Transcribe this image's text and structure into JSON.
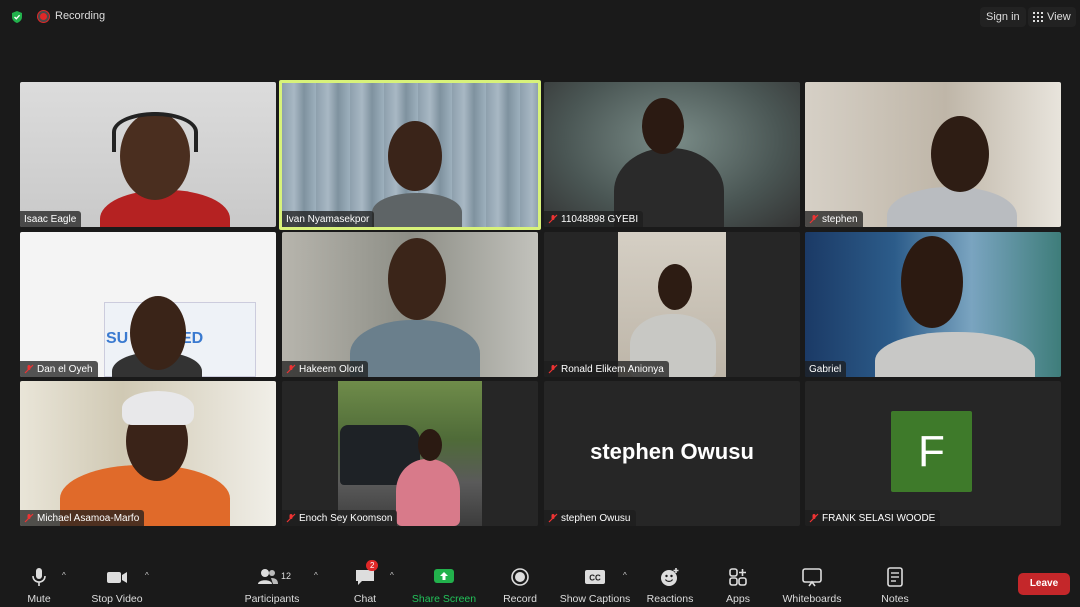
{
  "topbar": {
    "recording_label": "Recording",
    "signin_label": "Sign in",
    "view_label": "View"
  },
  "tiles": [
    {
      "name": "Isaac Eagle",
      "muted": false
    },
    {
      "name": "Ivan Nyamasekpor",
      "muted": false,
      "active": true
    },
    {
      "name": "11048898 GYEBI",
      "muted": true
    },
    {
      "name": "stephen",
      "muted": true
    },
    {
      "name": "Dan el Oyeh",
      "muted": true,
      "banner_text": "SU    ARGED"
    },
    {
      "name": "Hakeem Olord",
      "muted": true
    },
    {
      "name": "Ronald Elikem Anionya",
      "muted": true
    },
    {
      "name": "Gabriel",
      "muted": false
    },
    {
      "name": "Michael Asamoa-Marfo",
      "muted": true
    },
    {
      "name": "Enoch Sey Koomson",
      "muted": true
    },
    {
      "name": "stephen Owusu",
      "muted": true,
      "display_text": "stephen Owusu"
    },
    {
      "name": "FRANK SELASI WOODE",
      "muted": true,
      "avatar_letter": "F"
    }
  ],
  "toolbar": {
    "mute": "Mute",
    "stop_video": "Stop Video",
    "participants": "Participants",
    "participants_count": "12",
    "chat": "Chat",
    "chat_badge": "2",
    "share_screen": "Share Screen",
    "record": "Record",
    "captions": "Show Captions",
    "reactions": "Reactions",
    "apps": "Apps",
    "whiteboards": "Whiteboards",
    "notes": "Notes",
    "leave": "Leave"
  },
  "colors": {
    "active_border": "#d8f27a",
    "share_green": "#22b14c",
    "leave_red": "#c4272a",
    "avatar_green": "#3e7a2a"
  }
}
